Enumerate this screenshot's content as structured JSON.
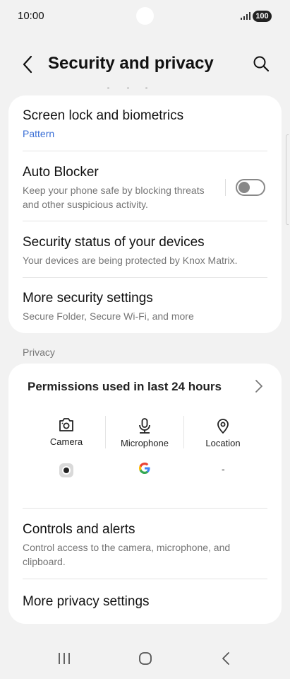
{
  "status_bar": {
    "time": "10:00",
    "battery": "100"
  },
  "header": {
    "title": "Security and privacy"
  },
  "security_card": {
    "items": [
      {
        "title": "Screen lock and biometrics",
        "subtitle": "Pattern"
      },
      {
        "title": "Auto Blocker",
        "subtitle": "Keep your phone safe by blocking threats and other suspicious activity.",
        "toggle_on": false
      },
      {
        "title": "Security status of your devices",
        "subtitle": "Your devices are being protected by Knox Matrix."
      },
      {
        "title": "More security settings",
        "subtitle": "Secure Folder, Secure Wi-Fi, and more"
      }
    ]
  },
  "privacy": {
    "section_label": "Privacy",
    "permissions_title": "Permissions used in last 24 hours",
    "permissions": [
      {
        "label": "Camera",
        "icon": "camera-icon",
        "app": "camera-app-icon"
      },
      {
        "label": "Microphone",
        "icon": "microphone-icon",
        "app": "google-app-icon"
      },
      {
        "label": "Location",
        "icon": "location-icon",
        "app": "-"
      }
    ],
    "items": [
      {
        "title": "Controls and alerts",
        "subtitle": "Control access to the camera, microphone, and clipboard."
      },
      {
        "title": "More privacy settings"
      }
    ]
  },
  "colors": {
    "accent_blue": "#3a6fd6",
    "background": "#f2f2f2"
  }
}
